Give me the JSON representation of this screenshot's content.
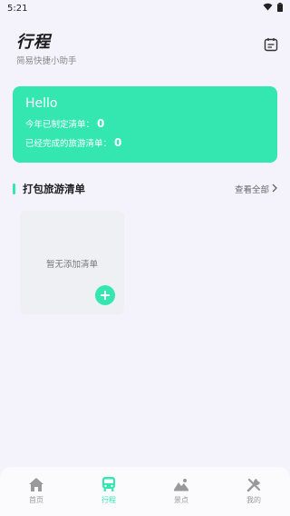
{
  "status_bar": {
    "time": "5:21"
  },
  "header": {
    "title": "行程",
    "subtitle": "简易快捷小助手",
    "calendar_icon": "calendar-icon"
  },
  "summary": {
    "greeting": "Hello",
    "created_label": "今年已制定清单：",
    "created_count": "0",
    "completed_label": "已经完成的旅游清单：",
    "completed_count": "0"
  },
  "section": {
    "title": "打包旅游清单",
    "view_all": "查看全部"
  },
  "empty_card": {
    "text": "暂无添加清单",
    "add_icon": "plus-icon"
  },
  "tabs": [
    {
      "label": "首页",
      "icon": "home-icon",
      "active": false
    },
    {
      "label": "行程",
      "icon": "bus-icon",
      "active": true
    },
    {
      "label": "景点",
      "icon": "mountain-icon",
      "active": false
    },
    {
      "label": "我的",
      "icon": "tools-icon",
      "active": false
    }
  ],
  "colors": {
    "accent": "#34e6b0",
    "background": "#f4f2fb",
    "inactive": "#999999"
  }
}
